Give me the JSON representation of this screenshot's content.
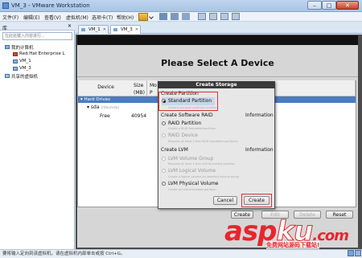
{
  "window": {
    "title": "VM_3 - VMware Workstation"
  },
  "menu": [
    "文件(F)",
    "编辑(E)",
    "查看(V)",
    "虚拟机(M)",
    "选项卡(T)",
    "帮助(H)"
  ],
  "library": {
    "title": "库",
    "search_placeholder": "在此处键入内容进行...",
    "tree": [
      "我的计算机",
      "Red Hat Enterprise L",
      "VM_1",
      "VM_3",
      "共享的虚拟机"
    ]
  },
  "tabs": [
    {
      "label": "VM_1"
    },
    {
      "label": "VM_3"
    }
  ],
  "installer": {
    "heading": "Please Select A Device",
    "columns": {
      "device": "Device",
      "size": "Size (MB)",
      "mount": "Mo P R"
    },
    "hard_drives": "Hard Drives",
    "sda": "sda",
    "sda_path": "(/dev/sda)",
    "free": "Free",
    "free_size": "40954",
    "buttons": {
      "create": "Create",
      "edit": "Edit",
      "delete": "Delete",
      "reset": "Reset"
    }
  },
  "dialog": {
    "title": "Create Storage",
    "partition_section": "Create Partition",
    "standard_partition": "Standard Partition",
    "standard_partition_sub": "General purpose partition creation",
    "raid_section": "Create Software RAID",
    "raid_info": "Information",
    "raid_partition": "RAID Partition",
    "raid_partition_sub": "Create a RAID formatted partition",
    "raid_device": "RAID Device",
    "raid_device_sub": "Requires at least 2 free RAID formatted partitions",
    "lvm_section": "Create LVM",
    "lvm_info": "Information",
    "lvm_vg": "LVM Volume Group",
    "lvm_vg_sub": "Requires at least 1 free LVM formatted partition",
    "lvm_lv": "LVM Logical Volume",
    "lvm_lv_sub": "Create a logical volume on selected volume group",
    "lvm_pv": "LVM Physical Volume",
    "lvm_pv_sub": "Create an LVM formatted partition",
    "cancel": "Cancel",
    "create": "Create"
  },
  "statusbar": {
    "text": "要将输入定向到该虚拟机，请在虚拟机内部单击或按 Ctrl+G。"
  },
  "watermark": {
    "main_a": "asp",
    "main_b": "ku",
    "main_c": ".com",
    "sub": "免费网站源码下载站!"
  },
  "colors": {
    "highlight": "#e03030",
    "selection": "#4a7cc0"
  }
}
